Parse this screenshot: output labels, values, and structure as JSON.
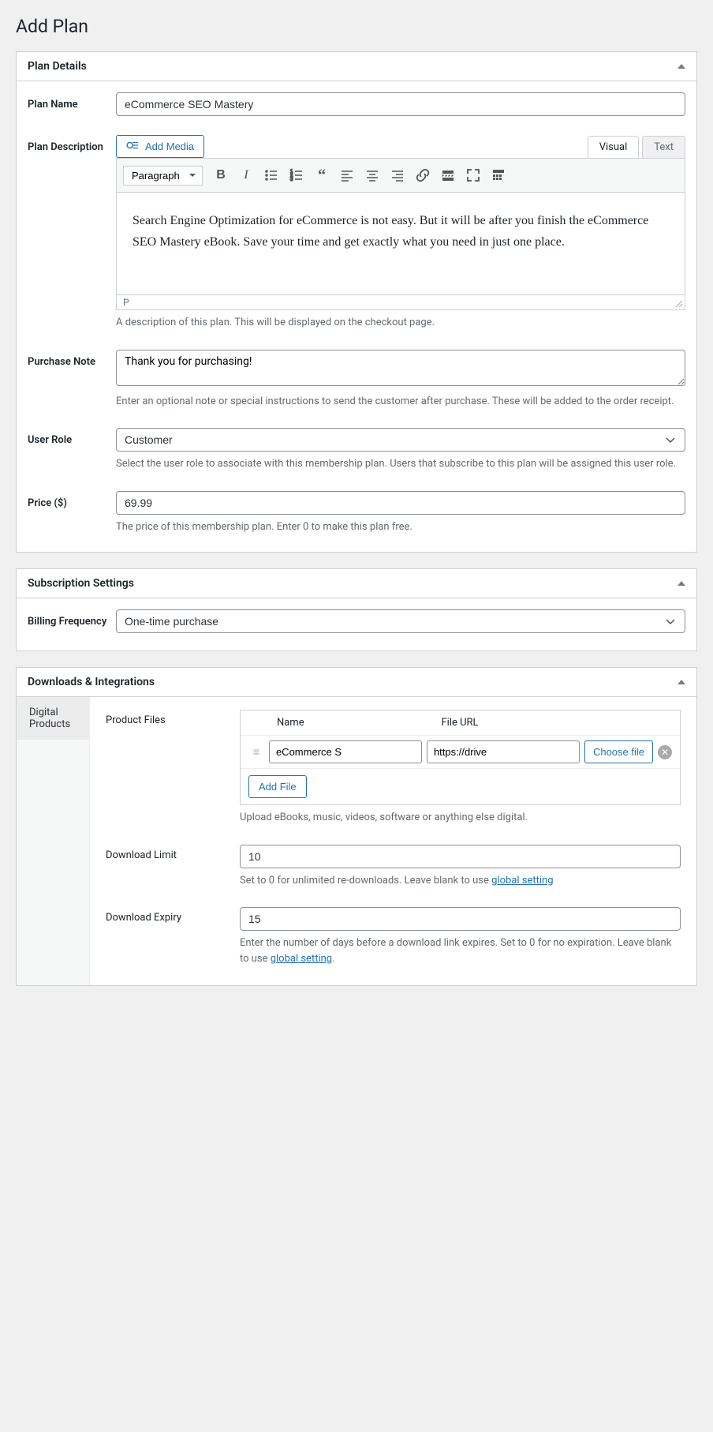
{
  "page_title": "Add Plan",
  "panels": {
    "plan_details": {
      "title": "Plan Details",
      "plan_name": {
        "label": "Plan Name",
        "value": "eCommerce SEO Mastery"
      },
      "plan_description": {
        "label": "Plan Description",
        "add_media": "Add Media",
        "tab_visual": "Visual",
        "tab_text": "Text",
        "format_select": "Paragraph",
        "content": "Search Engine Optimization for eCommerce is not easy. But it will be after you finish the eCommerce SEO Mastery eBook. Save your time and get exactly what you need in just one place.",
        "status": "P",
        "help": "A description of this plan. This will be displayed on the checkout page."
      },
      "purchase_note": {
        "label": "Purchase Note",
        "value": "Thank you for purchasing!",
        "help": "Enter an optional note or special instructions to send the customer after purchase. These will be added to the order receipt."
      },
      "user_role": {
        "label": "User Role",
        "value": "Customer",
        "help": "Select the user role to associate with this membership plan. Users that subscribe to this plan will be assigned this user role."
      },
      "price": {
        "label": "Price ($)",
        "value": "69.99",
        "help": "The price of this membership plan. Enter 0 to make this plan free."
      }
    },
    "subscription": {
      "title": "Subscription Settings",
      "billing_frequency": {
        "label": "Billing Frequency",
        "value": "One-time purchase"
      }
    },
    "downloads": {
      "title": "Downloads & Integrations",
      "sidebar": {
        "digital_products": "Digital Products"
      },
      "product_files": {
        "label": "Product Files",
        "col_name": "Name",
        "col_url": "File URL",
        "row": {
          "name": "eCommerce S",
          "url": "https://drive"
        },
        "choose_file": "Choose file",
        "add_file": "Add File",
        "help": "Upload eBooks, music, videos, software or anything else digital."
      },
      "download_limit": {
        "label": "Download Limit",
        "value": "10",
        "help_before": "Set to 0 for unlimited re-downloads. Leave blank to use ",
        "help_link": "global setting"
      },
      "download_expiry": {
        "label": "Download Expiry",
        "value": "15",
        "help_before": "Enter the number of days before a download link expires. Set to 0 for no expiration. Leave blank to use ",
        "help_link": "global setting",
        "help_after": "."
      }
    }
  }
}
